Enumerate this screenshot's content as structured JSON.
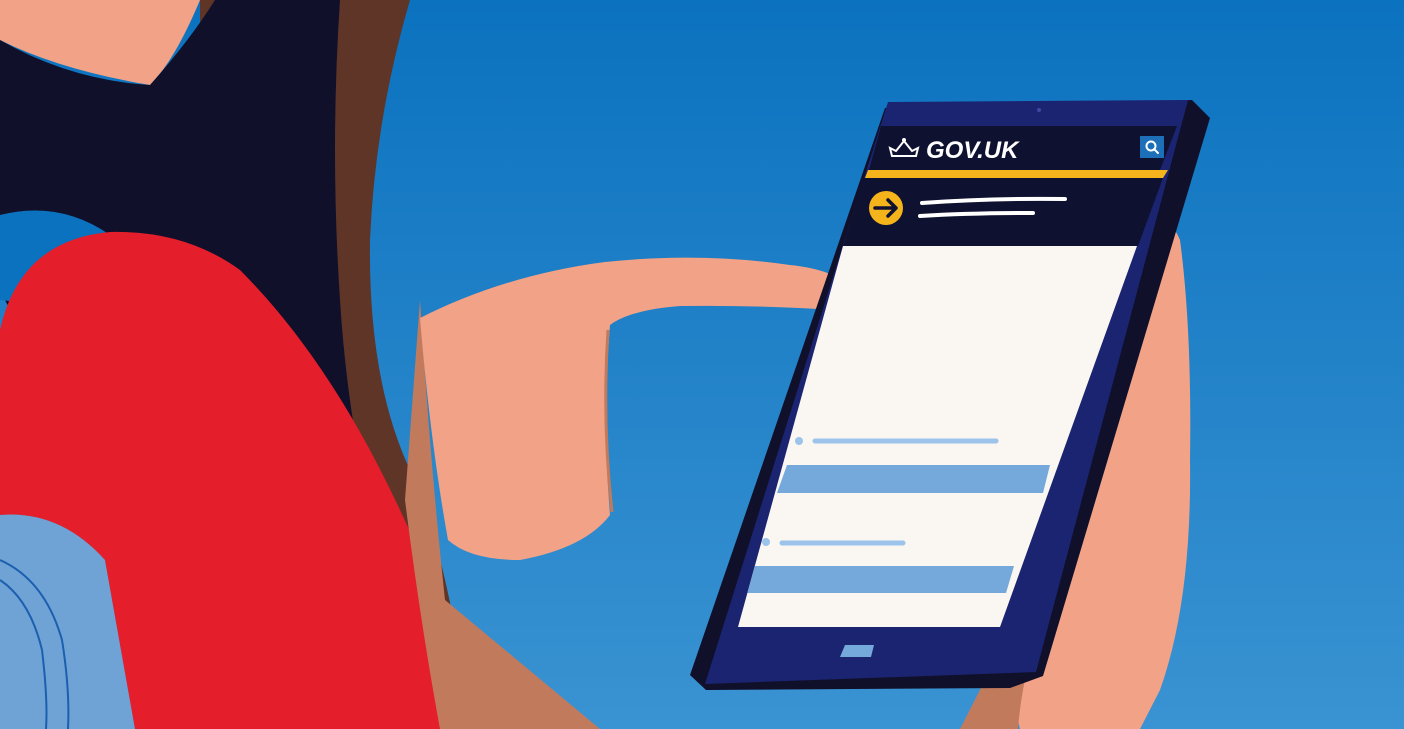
{
  "scene": {
    "background_top": "#0b72bf",
    "background_bottom": "#3a93d2",
    "sweater": "#e41e2b",
    "hair": "#5e3527",
    "collar": "#10102b",
    "skin": "#f2a286",
    "skin_shadow": "#c27a5d",
    "backpack": "#6fa3d6"
  },
  "phone": {
    "body_color": "#1b2470",
    "header_color": "#0f1131",
    "accent_color": "#f5b41c",
    "screen_color": "#faf6f2",
    "link_color": "#9cc3ea",
    "block_color": "#75a9db",
    "header": {
      "crown_icon": "crown-icon",
      "title": "GOV.UK",
      "search_icon": "search-icon"
    },
    "banner_icon": "arrow-right-icon"
  }
}
